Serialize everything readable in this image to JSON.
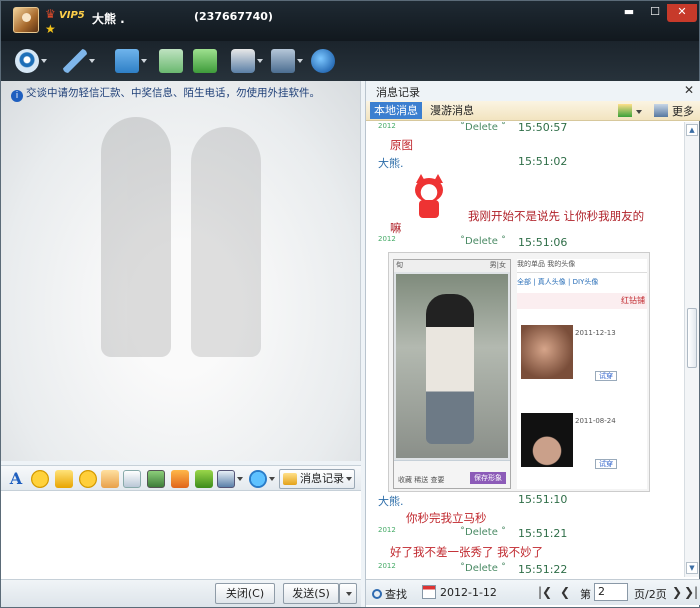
{
  "titlebar": {
    "vip": "VIP5",
    "nickname": "大熊 .",
    "qq_number": "(237667740)",
    "minimize": "▬",
    "maximize": "☐",
    "close": "✕"
  },
  "notice": "交谈中请勿轻信汇款、中奖信息、陌生电话，勿使用外挂软件。",
  "format_bar": {
    "font_glyph": "A",
    "msg_record_label": "消息记录"
  },
  "buttons": {
    "close": "关闭(C)",
    "send": "发送(S)"
  },
  "history_panel": {
    "title": "消息记录",
    "close": "✕",
    "tab_local": "本地消息",
    "tab_roaming": "漫游消息",
    "more": "更多",
    "entries": {
      "r1_year": "2012",
      "r1_delete": "˚Delete ˚",
      "r1_time": "15:50:57",
      "r1_text": "原图",
      "r2_sender": "大熊.",
      "r2_time": "15:51:02",
      "r2_text": "我刚开始不是说先 让你秒我朋友的",
      "r2_text2": "嘛",
      "r3_year": "2012",
      "r3_delete": "˚Delete ˚",
      "r3_time": "15:51:06",
      "r4_sender": "大熊.",
      "r4_time": "15:51:10",
      "r4_text": "你秒完我立马秒",
      "r5_year": "2012",
      "r5_delete": "˚Delete ˚",
      "r5_time": "15:51:21",
      "r5_text": "好了我不差一张秀了 我不妙了",
      "r6_year": "2012",
      "r6_delete": "˚Delete ˚",
      "r6_time": "15:51:22"
    },
    "screenshot": {
      "phone_top": "旬",
      "phone_gender": "男|女",
      "phone_actions": "收藏  稀送  查要",
      "phone_save": "保存形象",
      "web_tabs": "我的单品   我的头像",
      "web_subnav": "全部 | 真人头像 | DIY头像",
      "web_red": "红钻铺",
      "date1": "2011-12-13",
      "date2": "2011-08-24",
      "try_label": "试穿"
    },
    "bottom": {
      "find": "查找",
      "date": "2012-1-12",
      "first": "|❮",
      "prev": "❮",
      "page_prefix": "第",
      "page_value": "2",
      "pages": "页/2页",
      "next": "❯",
      "last": "❯|"
    }
  }
}
